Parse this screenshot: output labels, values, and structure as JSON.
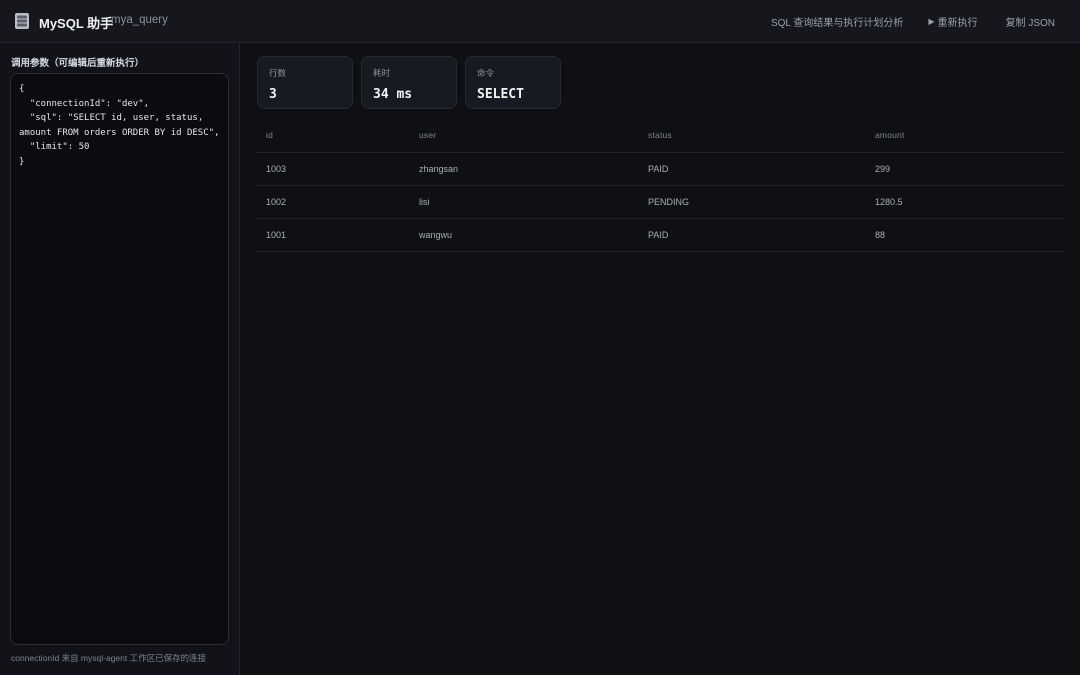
{
  "header": {
    "title": "MySQL 助手",
    "subtitle": "mya_query",
    "description": "SQL 查询结果与执行计划分析",
    "rerun_label": "重新执行",
    "copy_label": "复制 JSON"
  },
  "sidebar": {
    "label": "调用参数（可编辑后重新执行）",
    "params": "{\n  \"connectionId\": \"dev\",\n  \"sql\": \"SELECT id, user, status,\namount FROM orders ORDER BY id DESC\",\n  \"limit\": 50\n}",
    "note": "connectionId 来自 mysql-agent 工作区已保存的连接"
  },
  "stats": {
    "rows_label": "行数",
    "rows_value": "3",
    "time_label": "耗时",
    "time_value": "34 ms",
    "command_label": "命令",
    "command_value": "SELECT"
  },
  "table": {
    "columns": [
      "id",
      "user",
      "status",
      "amount"
    ],
    "rows": [
      [
        "1003",
        "zhangsan",
        "PAID",
        "299"
      ],
      [
        "1002",
        "lisi",
        "PENDING",
        "1280.5"
      ],
      [
        "1001",
        "wangwu",
        "PAID",
        "88"
      ]
    ]
  },
  "colors": {
    "background": "#0e1014",
    "panel": "#15171c",
    "text": "#c9ced6"
  },
  "icons": {
    "app": "database-icon",
    "rerun": "play-icon"
  }
}
